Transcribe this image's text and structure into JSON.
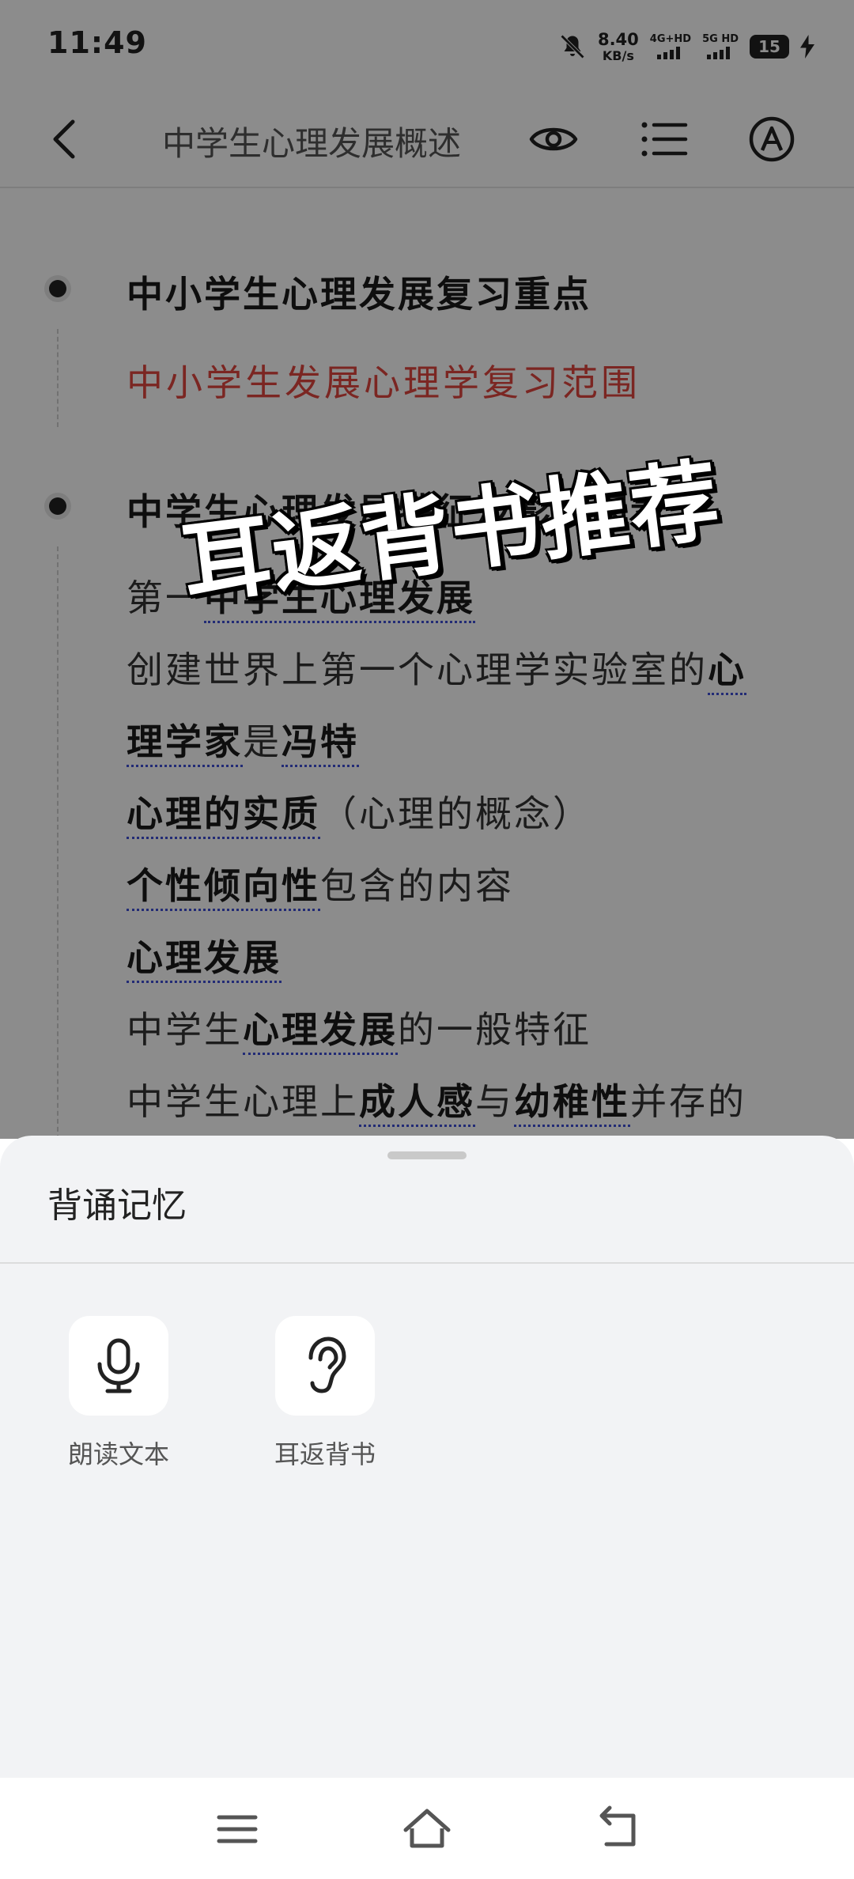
{
  "status_bar": {
    "time": "11:49",
    "net_speed_value": "8.40",
    "net_speed_unit": "KB/s",
    "sim1_label": "4G+HD",
    "sim2_label": "5G HD",
    "battery": "15"
  },
  "top_bar": {
    "title": "中学生心理发展概述"
  },
  "outline": {
    "section1_heading": "中小学生心理发展复习重点",
    "section1_sub": "中小学生发展心理学复习范围",
    "section2_heading": "中学生心理发展特征及影响因素",
    "line_first": "第一",
    "line_first_kw": "中学生心理发展",
    "line2_text": "创建世界上第一个心理学实验室的",
    "line2_kw": "心",
    "line3_kw1": "理学家",
    "line3_mid": "是",
    "line3_kw2": "冯特",
    "line4_kw": "心理的实质",
    "line4_rest": "（心理的概念）",
    "line5_kw": "个性倾向性",
    "line5_rest": "包含的内容",
    "line6_kw": "心理发展",
    "line7_pre": "中学生",
    "line7_kw": "心理发展",
    "line7_rest": "的一般特征",
    "line8_pre": "中学生心理上",
    "line8_kw1": "成人感",
    "line8_mid": "与",
    "line8_kw2": "幼稚性",
    "line8_rest": "并存的"
  },
  "promo_overlay": "耳返背书推荐",
  "sheet": {
    "title": "背诵记忆",
    "actions": [
      {
        "label": "朗读文本",
        "icon": "microphone-icon"
      },
      {
        "label": "耳返背书",
        "icon": "ear-icon"
      }
    ]
  },
  "nav_bar": {
    "icons": [
      "menu-icon",
      "home-icon",
      "back-icon"
    ]
  }
}
